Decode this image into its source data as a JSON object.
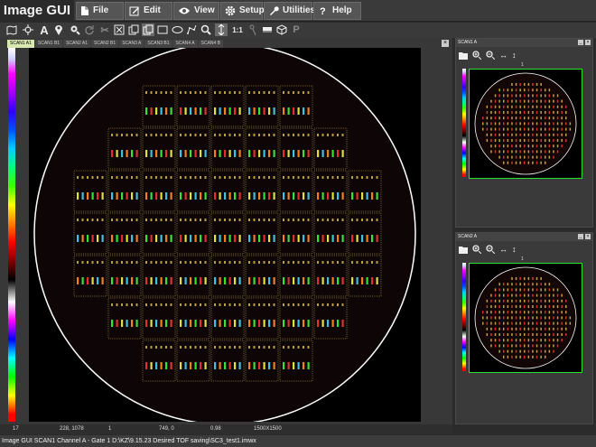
{
  "app": {
    "title": "Image GUI"
  },
  "menus": [
    {
      "label": "File",
      "icon": "document-icon"
    },
    {
      "label": "Edit",
      "icon": "pencil-box-icon"
    },
    {
      "label": "View",
      "icon": "eye-icon"
    },
    {
      "label": "Setup",
      "icon": "gear-icon"
    },
    {
      "label": "Utilities",
      "icon": "wrench-icon"
    },
    {
      "label": "Help",
      "icon": "question-icon"
    }
  ],
  "toolbar": {
    "tools": [
      "map-icon",
      "crosshair-icon",
      "text-icon",
      "pin-icon",
      "zoom-icon",
      "rotate-icon",
      "scissors-icon",
      "x-box-icon",
      "copy-icon",
      "select-copy-icon",
      "rectangle-icon",
      "ellipse-icon",
      "polyline-icon",
      "search-icon",
      "vertical-cursor-icon",
      "one-to-one-icon",
      "pin-alt-icon",
      "eraser-icon",
      "cube-icon",
      "peak-icon"
    ],
    "one_to_one_label": "1:1",
    "peak_label": "P"
  },
  "main": {
    "tabs": [
      "SCAN1 A1",
      "SCAN1 B1",
      "SCAN2 A1",
      "SCAN2 B1",
      "SCAN3 A",
      "SCAN3 B1",
      "SCAN4 A",
      "SCAN4 B"
    ],
    "active_tab": 0,
    "colorbar_label": "17",
    "status": {
      "left": "17",
      "coords": "228, 1078",
      "v1": "1",
      "v2": "749, 0",
      "v3": "0.98",
      "size": "1500X1500"
    }
  },
  "side_panels": [
    {
      "title": "SCAN1 A",
      "label": "1"
    },
    {
      "title": "SCAN2 A",
      "label": "1"
    }
  ],
  "statusbar": {
    "text": "Image GUI  SCAN1 Channel A - Gate 1 D:\\KZ\\9.15.23 Desired TOF saving\\SC3_test1.imwx"
  },
  "colors": {
    "wafer_edge": "#ffffff",
    "highlight": "#2ee02e",
    "die_border": "#c8b050",
    "background": "#000000"
  }
}
